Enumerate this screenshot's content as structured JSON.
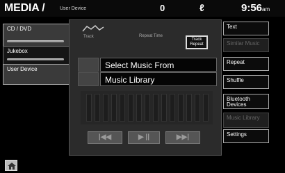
{
  "header": {
    "title": "MEDIA /",
    "subtitle": "User Device",
    "status_a": "0",
    "status_b": "ℓ",
    "time": "9:56",
    "time_suffix": "am"
  },
  "left_tabs": [
    {
      "label": "CD / DVD"
    },
    {
      "label": "Jukebox"
    },
    {
      "label": "User Device"
    }
  ],
  "main": {
    "track_label": "Track",
    "repeat_label": "Repeat Time",
    "repeat_box": "Track Repeat",
    "row1": "Select Music From",
    "row2": "Music Library",
    "transport": {
      "prev": "|◀◀",
      "play": "▶ ||",
      "next": "▶▶|"
    }
  },
  "right_buttons": [
    {
      "label": "Text",
      "enabled": true
    },
    {
      "label": "Similar Music",
      "enabled": false
    },
    {
      "label": "Repeat",
      "enabled": true
    },
    {
      "label": "Shuffle",
      "enabled": true
    },
    {
      "label": "Bluetooth Devices",
      "enabled": true
    },
    {
      "label": "Music Library",
      "enabled": false
    },
    {
      "label": "Settings",
      "enabled": true
    }
  ],
  "icons": {
    "home": "home-icon",
    "track": "track-icon"
  },
  "colors": {
    "background": "#000000",
    "panel": "#2b2b2b",
    "button_border": "#aaaaaa"
  }
}
